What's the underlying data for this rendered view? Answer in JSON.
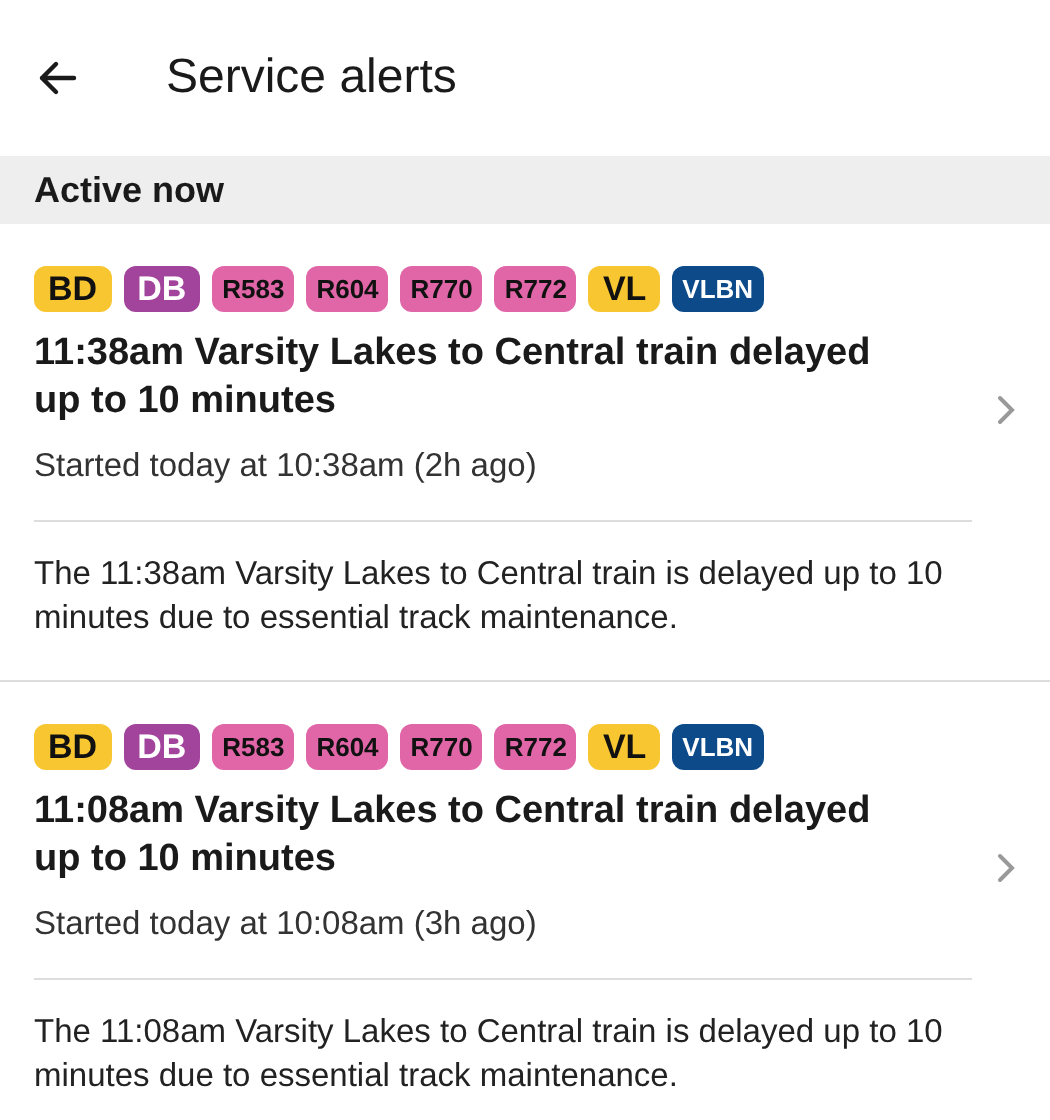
{
  "header": {
    "title": "Service alerts"
  },
  "section": {
    "title": "Active now"
  },
  "alerts": [
    {
      "badges": [
        {
          "text": "BD",
          "color": "#f8c630"
        },
        {
          "text": "DB",
          "color": "#a2449c"
        },
        {
          "text": "R583",
          "color": "#e066a8"
        },
        {
          "text": "R604",
          "color": "#e066a8"
        },
        {
          "text": "R770",
          "color": "#e066a8"
        },
        {
          "text": "R772",
          "color": "#e066a8"
        },
        {
          "text": "VL",
          "color": "#f8c630"
        },
        {
          "text": "VLBN",
          "color": "#0c4a8a"
        }
      ],
      "title": "11:38am Varsity Lakes to Central train delayed up to 10 minutes",
      "started": "Started today at 10:38am (2h ago)",
      "description": "The 11:38am Varsity Lakes to Central train is delayed up to 10 minutes due to essential track maintenance."
    },
    {
      "badges": [
        {
          "text": "BD",
          "color": "#f8c630"
        },
        {
          "text": "DB",
          "color": "#a2449c"
        },
        {
          "text": "R583",
          "color": "#e066a8"
        },
        {
          "text": "R604",
          "color": "#e066a8"
        },
        {
          "text": "R770",
          "color": "#e066a8"
        },
        {
          "text": "R772",
          "color": "#e066a8"
        },
        {
          "text": "VL",
          "color": "#f8c630"
        },
        {
          "text": "VLBN",
          "color": "#0c4a8a"
        }
      ],
      "title": "11:08am Varsity Lakes to Central train delayed up to 10 minutes",
      "started": "Started today at 10:08am (3h ago)",
      "description": "The 11:08am Varsity Lakes to Central train is delayed up to 10 minutes due to essential track maintenance."
    }
  ]
}
